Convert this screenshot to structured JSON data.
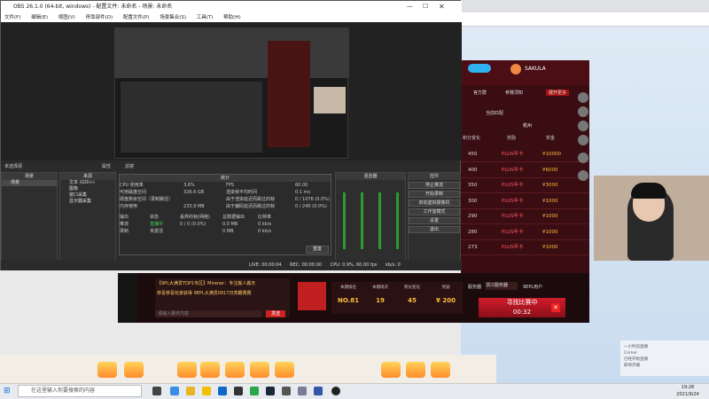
{
  "obs": {
    "title": "OBS 26.1.0 (64-bit, windows) - 配置文件: 未命名 - 场景: 未命名",
    "menu": [
      "文件(F)",
      "编辑(E)",
      "视图(V)",
      "停靠部件(D)",
      "配置文件(P)",
      "场景集合(S)",
      "工具(T)",
      "帮助(H)"
    ],
    "preview_label": "未选择源",
    "tabs": [
      "属性",
      "滤镜"
    ],
    "docks": {
      "scenes": {
        "title": "场景",
        "items": [
          "场景"
        ]
      },
      "sources": {
        "title": "来源",
        "items": [
          "文本 (GDI+)",
          "图像",
          "窗口采集",
          "显示器采集"
        ]
      },
      "mixer": {
        "title": "混音器"
      },
      "controls": {
        "title": "控件",
        "buttons": [
          "停止推流",
          "开始录制",
          "启动虚拟摄像机",
          "工作室模式",
          "设置",
          "退出"
        ]
      }
    },
    "stats": {
      "title": "统计",
      "lines": [
        [
          "CPU 使用率",
          "3.6%",
          "FPS",
          "60.00"
        ],
        [
          "可用磁盘空间",
          "326.6 GB",
          "渲染帧平均时间",
          "0.1 ms"
        ],
        [
          "硬盘剩余空间（录制路径）",
          "",
          "由于渲染延迟而跳过的帧",
          "0 / 1076 (0.0%)"
        ],
        [
          "内存使用",
          "233.9 MB",
          "由于编码延迟而跳过的帧",
          "0 / 240 (0.0%)"
        ]
      ],
      "table_headers": [
        "输出",
        "状态",
        "丢弃的帧(网络)",
        "总数据输出",
        "比特率"
      ],
      "table_rows": [
        [
          "推流",
          "直播中",
          "0 / 0 (0.0%)",
          "0.0 MB",
          "0 kb/s"
        ],
        [
          "录制",
          "未激活",
          "",
          "0 MB",
          "0 kb/s"
        ]
      ],
      "reset_label": "重置"
    },
    "status": {
      "live": "LIVE: 00:00:04",
      "rec": "REC: 00:00:00",
      "cpu": "CPU: 0.9%, 60.00 fps",
      "bitrate": "kb/s: 0"
    }
  },
  "game": {
    "user_name": "SAKULA",
    "nav": [
      "官方群",
      "参赛须知",
      "展开更多"
    ],
    "region": "杭州",
    "filter_label": "当前匹配",
    "columns": [
      "积分变化",
      "奖励",
      "奖金"
    ],
    "rows": [
      {
        "score": "450",
        "reward": "PLUS年卡",
        "prize": "¥10000"
      },
      {
        "score": "400",
        "reward": "PLUS年卡",
        "prize": "¥6000"
      },
      {
        "score": "350",
        "reward": "PLUS年卡",
        "prize": "¥3000"
      },
      {
        "score": "300",
        "reward": "PLUS年卡",
        "prize": "¥1000"
      },
      {
        "score": "290",
        "reward": "PLUS年卡",
        "prize": "¥1000"
      },
      {
        "score": "280",
        "reward": "PLUS年卡",
        "prize": "¥1000"
      },
      {
        "score": "273",
        "reward": "PLUS年卡",
        "prize": "¥1000"
      }
    ],
    "chat_lines": [
      "【9PL大满贯TOP1专区】Mirener：专注搬人搬天",
      "恭喜恭喜玩家获得 9EPL大满贯0917日亮霸赛赛"
    ],
    "chat_placeholder": "请输入聊天内容",
    "send_label": "发送",
    "stats": [
      {
        "label": "本期排名",
        "value": "NO.81"
      },
      {
        "label": "本期场次",
        "value": "19"
      },
      {
        "label": "积分变化",
        "value": "45"
      },
      {
        "label": "奖励",
        "value": "¥ 200"
      }
    ],
    "server": "服务器",
    "server_value": "浙江服务器",
    "mode": "9EPL用户",
    "search_label": "寻找比赛中",
    "search_time": "00:32"
  },
  "notification": {
    "lines": [
      "一小时前直播",
      "Corner",
      "已经开始直播",
      "即将开播"
    ]
  },
  "taskbar": {
    "search_placeholder": "在这里输入你要搜索的内容",
    "time": "19:28",
    "date": "2021/9/24"
  }
}
